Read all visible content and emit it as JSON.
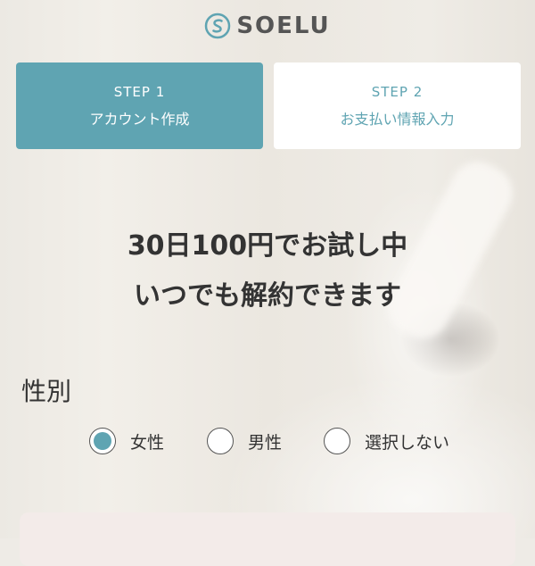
{
  "brand": {
    "name": "SOELU"
  },
  "steps": [
    {
      "number": "STEP 1",
      "label": "アカウント作成",
      "active": true
    },
    {
      "number": "STEP 2",
      "label": "お支払い情報入力",
      "active": false
    }
  ],
  "headline": {
    "line1": "30日100円でお試し中",
    "line2": "いつでも解約できます"
  },
  "gender": {
    "label": "性別",
    "options": [
      {
        "label": "女性",
        "selected": true
      },
      {
        "label": "男性",
        "selected": false
      },
      {
        "label": "選択しない",
        "selected": false
      }
    ]
  },
  "colors": {
    "accent": "#5fa4b2",
    "text": "#333333"
  }
}
